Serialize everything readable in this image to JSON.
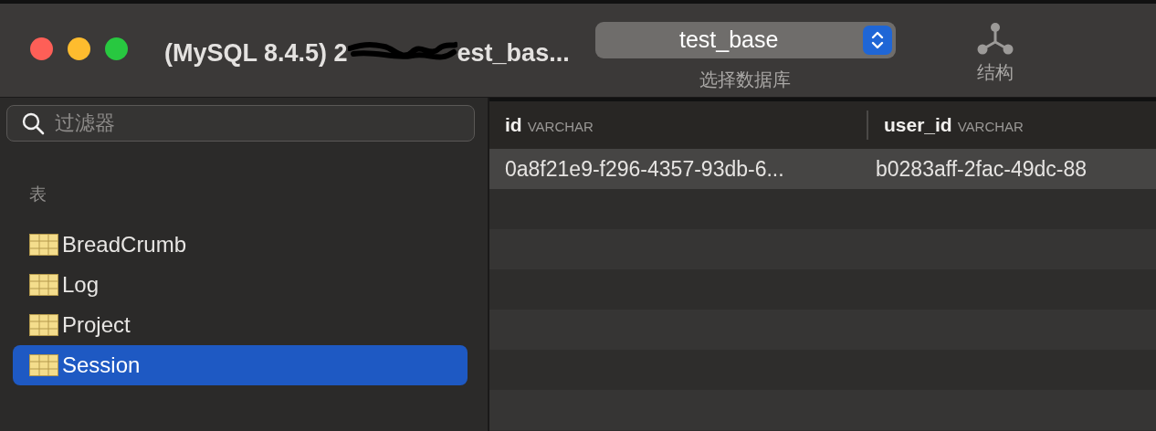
{
  "window": {
    "title_start": "(MySQL 8.4.5) 2",
    "title_end": "est_bas..."
  },
  "toolbar": {
    "database_select": {
      "value": "test_base",
      "caption": "选择数据库"
    },
    "structure": {
      "label": "结构"
    }
  },
  "sidebar": {
    "filter": {
      "placeholder": "过滤器"
    },
    "section": "表",
    "tables": [
      {
        "name": "BreadCrumb",
        "selected": false
      },
      {
        "name": "Log",
        "selected": false
      },
      {
        "name": "Project",
        "selected": false
      },
      {
        "name": "Session",
        "selected": true
      }
    ]
  },
  "table": {
    "columns": [
      {
        "name": "id",
        "type": "VARCHAR"
      },
      {
        "name": "user_id",
        "type": "VARCHAR"
      }
    ],
    "rows": [
      [
        "0a8f21e9-f296-4357-93db-6...",
        "b0283aff-2fac-49dc-88"
      ]
    ]
  }
}
